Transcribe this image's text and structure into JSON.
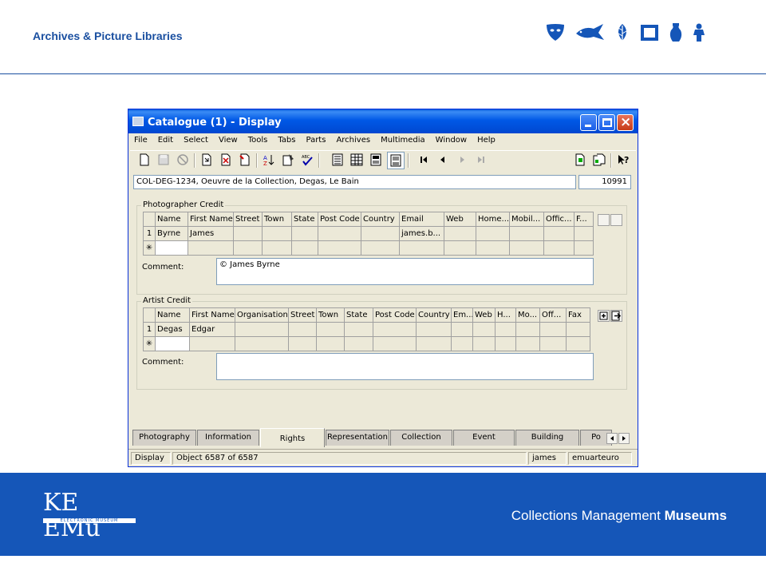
{
  "slide": {
    "title": "Archives & Picture Libraries",
    "icons": [
      "mask-icon",
      "fish-icon",
      "leaf-icon",
      "frame-icon",
      "vase-icon",
      "figure-icon"
    ]
  },
  "footer": {
    "logo_text": "KE EMu",
    "logo_subtext": "ELECTRONIC MUSEUM",
    "tagline_plain": "Collections Management",
    "tagline_bold": "Museums"
  },
  "window": {
    "title": "Catalogue (1) - Display",
    "menu": [
      "File",
      "Edit",
      "Select",
      "View",
      "Tools",
      "Tabs",
      "Parts",
      "Archives",
      "Multimedia",
      "Window",
      "Help"
    ],
    "record_summary": "COL-DEG-1234, Oeuvre de la Collection, Degas, Le Bain",
    "record_count": "10991",
    "photographer_credit": {
      "legend": "Photographer Credit",
      "columns": [
        "Name",
        "First Name",
        "Street",
        "Town",
        "State",
        "Post Code",
        "Country",
        "Email",
        "Web",
        "Home...",
        "Mobil...",
        "Offic...",
        "F..."
      ],
      "rows": [
        {
          "num": "1",
          "cells": [
            "Byrne",
            "James",
            "",
            "",
            "",
            "",
            "",
            "james.b...",
            "",
            "",
            "",
            "",
            ""
          ]
        }
      ],
      "new_row_marker": "✳",
      "comment_label": "Comment:",
      "comment": "© James Byrne"
    },
    "artist_credit": {
      "legend": "Artist Credit",
      "columns": [
        "Name",
        "First Name",
        "Organisation",
        "Street",
        "Town",
        "State",
        "Post Code",
        "Country",
        "Em...",
        "Web",
        "H...",
        "Mo...",
        "Off...",
        "Fax"
      ],
      "rows": [
        {
          "num": "1",
          "cells": [
            "Degas",
            "Edgar",
            "",
            "",
            "",
            "",
            "",
            "",
            "",
            "",
            "",
            "",
            "",
            ""
          ]
        }
      ],
      "new_row_marker": "✳",
      "comment_label": "Comment:",
      "comment": ""
    },
    "tabs": [
      "Photography",
      "Information",
      "Rights",
      "Representation",
      "Collection",
      "Event",
      "Building",
      "Po"
    ],
    "active_tab": "Rights",
    "status": {
      "mode": "Display",
      "position": "Object 6587 of 6587",
      "user": "james",
      "db": "emuarteuro"
    }
  }
}
